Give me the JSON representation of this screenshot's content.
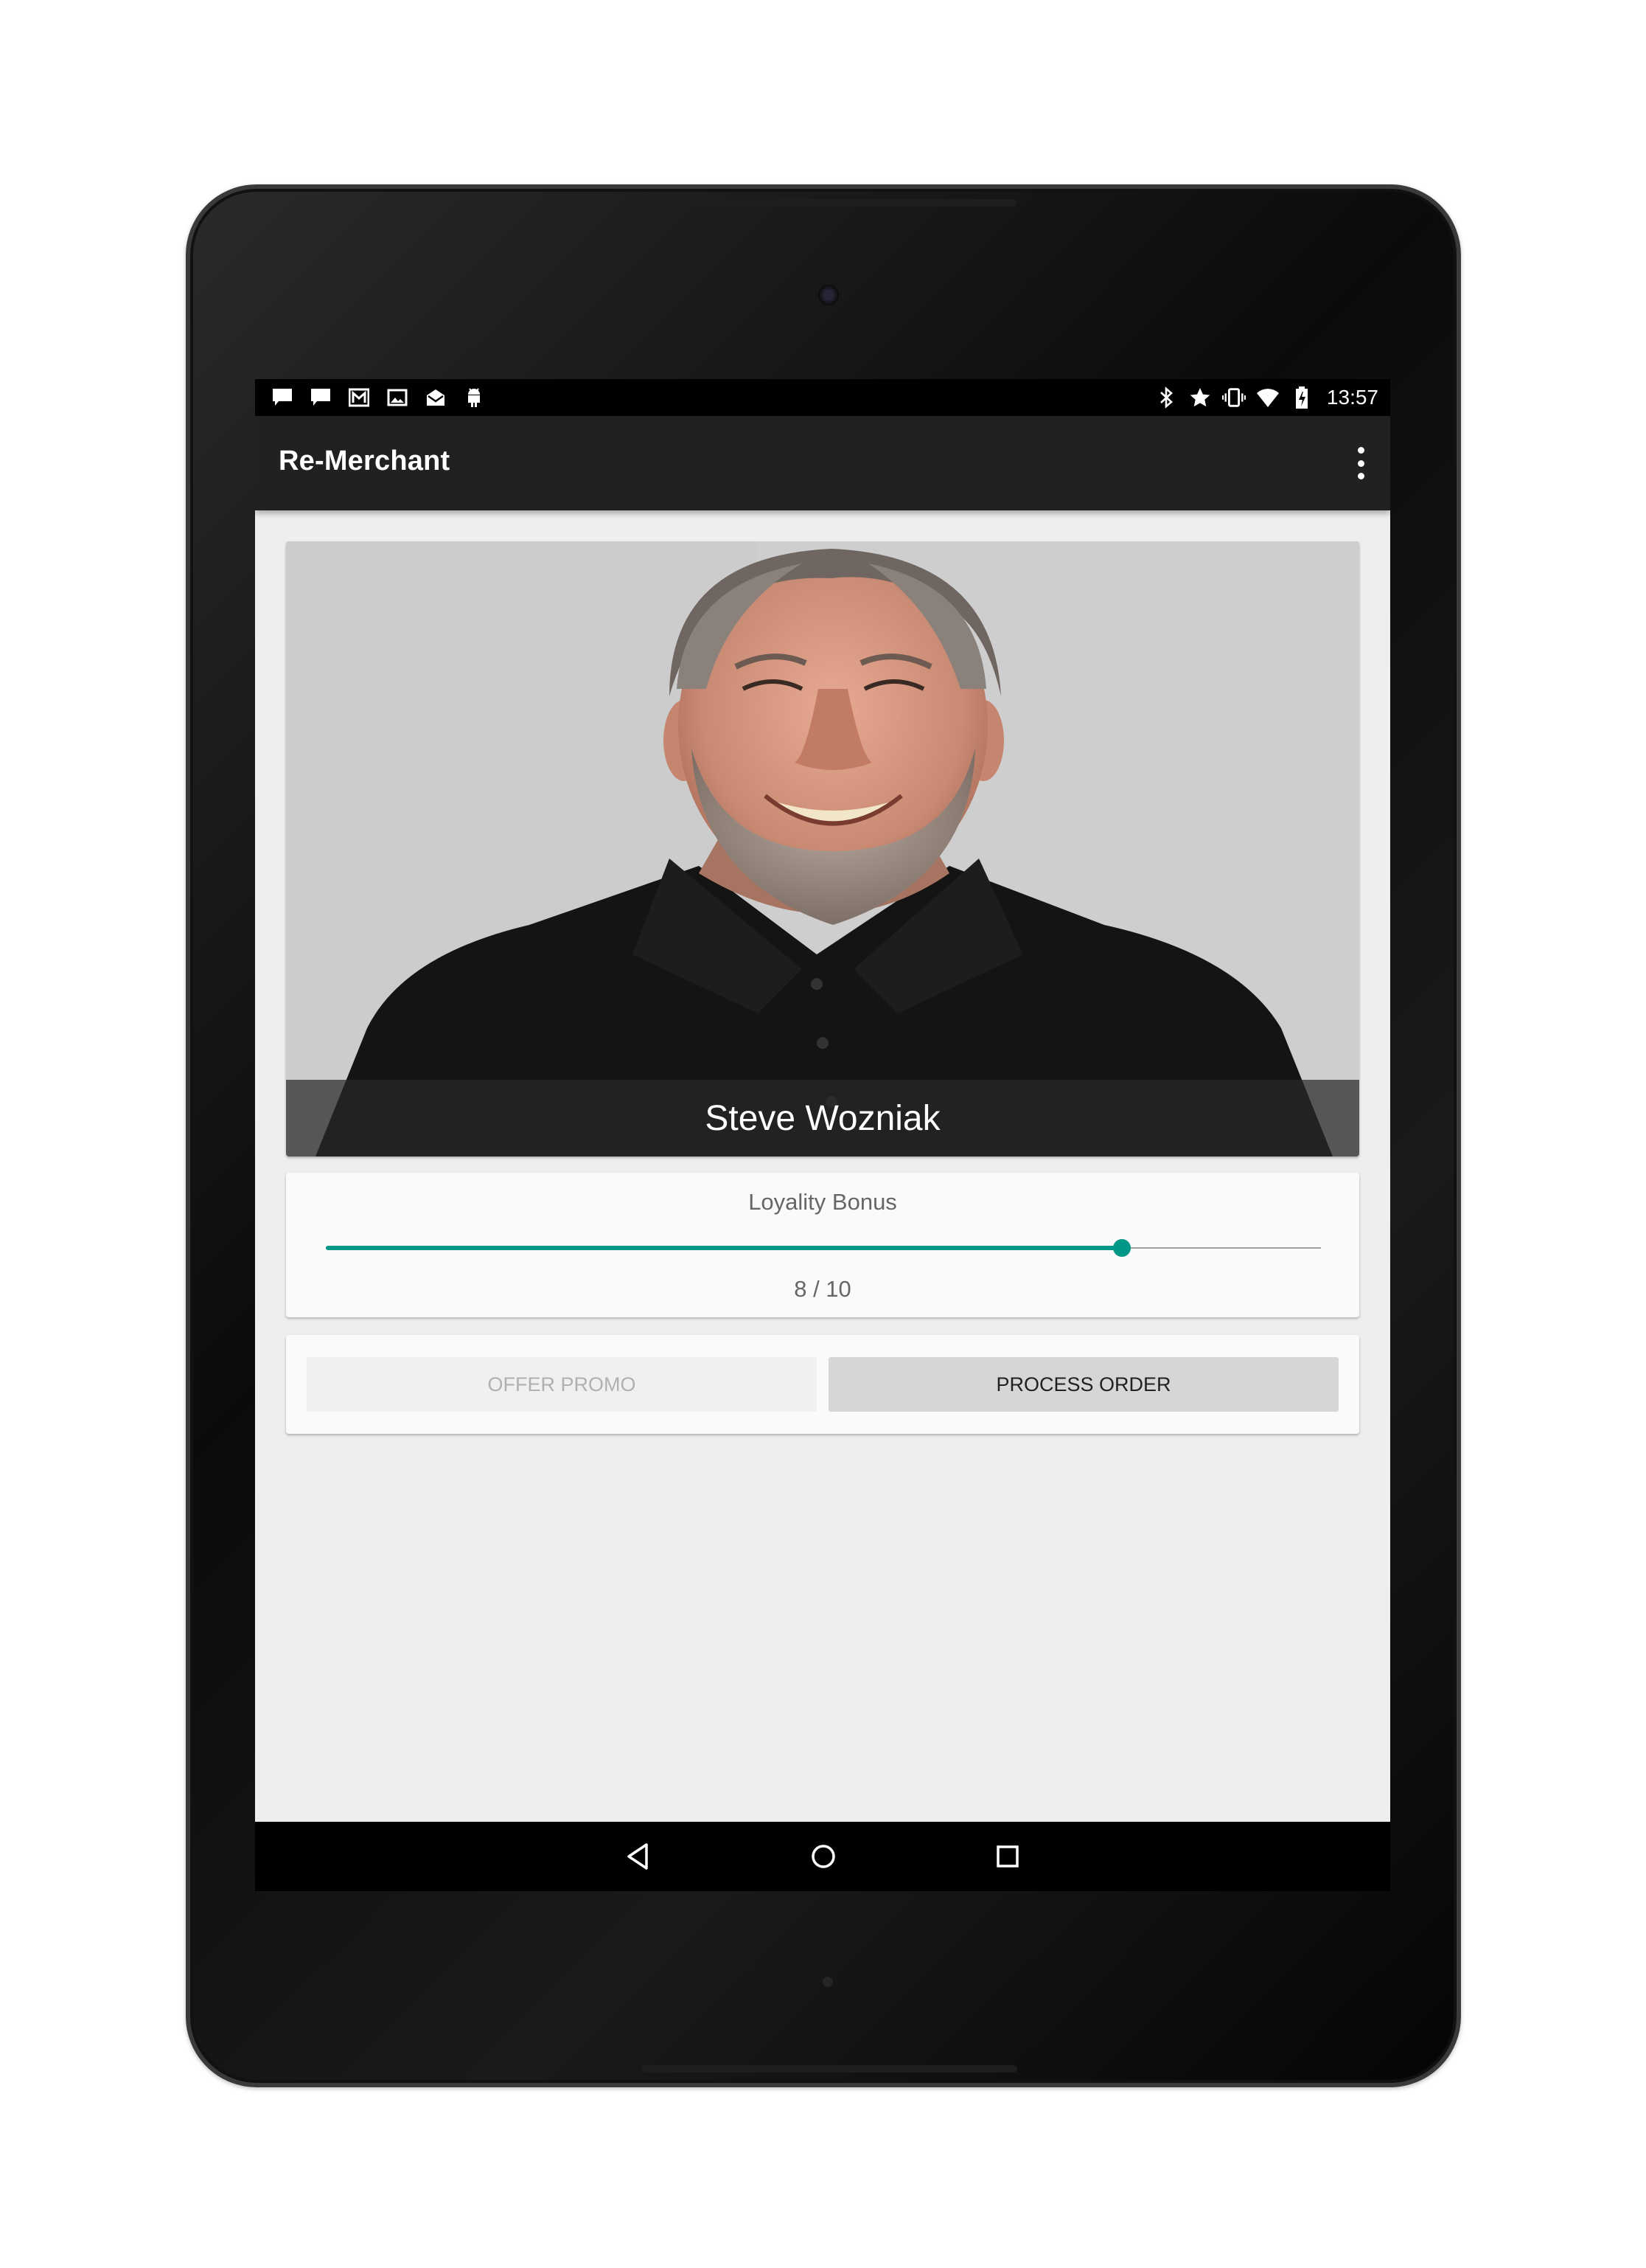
{
  "status_bar": {
    "notification_icons": [
      "chat-icon",
      "chat-icon",
      "gmail-icon",
      "image-icon",
      "mail-open-icon",
      "android-icon"
    ],
    "system_icons": [
      "bluetooth-icon",
      "star-icon",
      "vibrate-icon",
      "wifi-icon",
      "battery-charging-icon"
    ],
    "time": "13:57"
  },
  "app_bar": {
    "title": "Re-Merchant",
    "overflow_icon": "more-vert-icon"
  },
  "profile": {
    "name": "Steve Wozniak"
  },
  "loyalty": {
    "label": "Loyality Bonus",
    "value": 8,
    "max": 10,
    "display": "8 / 10",
    "accent_color": "#009688"
  },
  "actions": {
    "offer_promo": "OFFER PROMO",
    "process_order": "PROCESS ORDER"
  },
  "nav_bar": {
    "back_icon": "back-icon",
    "home_icon": "home-icon",
    "recents_icon": "recents-icon"
  }
}
